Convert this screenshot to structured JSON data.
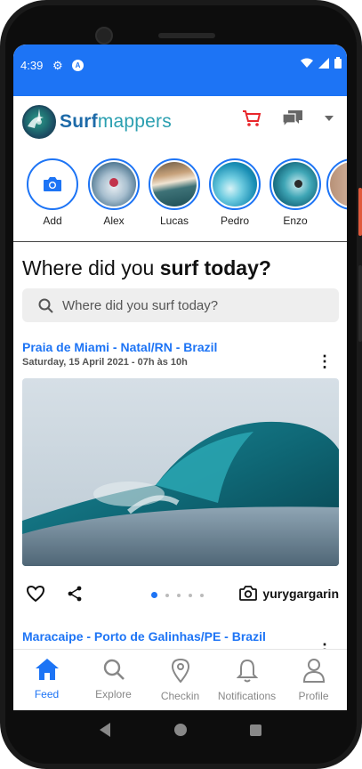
{
  "status": {
    "time": "4:39"
  },
  "header": {
    "brand_surf": "Surf",
    "brand_mappers": "mappers"
  },
  "stories": [
    {
      "name": "Add",
      "kind": "add"
    },
    {
      "name": "Alex",
      "kind": "photo"
    },
    {
      "name": "Lucas",
      "kind": "photo"
    },
    {
      "name": "Pedro",
      "kind": "photo"
    },
    {
      "name": "Enzo",
      "kind": "photo"
    }
  ],
  "question": {
    "part1": "Where did you ",
    "part2": "surf today?"
  },
  "search": {
    "placeholder": "Where did you surf today?"
  },
  "posts": [
    {
      "location": "Praia de Miami - Natal/RN - Brazil",
      "date": "Saturday, 15 April 2021 - 07h às 10h",
      "author": "yurygargarin",
      "carousel_count": 5,
      "carousel_active": 0
    },
    {
      "location": "Maracaipe - Porto de Galinhas/PE - Brazil"
    }
  ],
  "tabs": [
    {
      "label": "Feed",
      "icon": "home-icon",
      "active": true
    },
    {
      "label": "Explore",
      "icon": "search-icon",
      "active": false
    },
    {
      "label": "Checkin",
      "icon": "location-pin-icon",
      "active": false
    },
    {
      "label": "Notifications",
      "icon": "bell-icon",
      "active": false
    },
    {
      "label": "Profile",
      "icon": "person-icon",
      "active": false
    }
  ],
  "colors": {
    "accent": "#1d74f5",
    "cart": "#e8262b",
    "brand_dark": "#1d6aa8",
    "brand_light": "#2a9fb0"
  }
}
